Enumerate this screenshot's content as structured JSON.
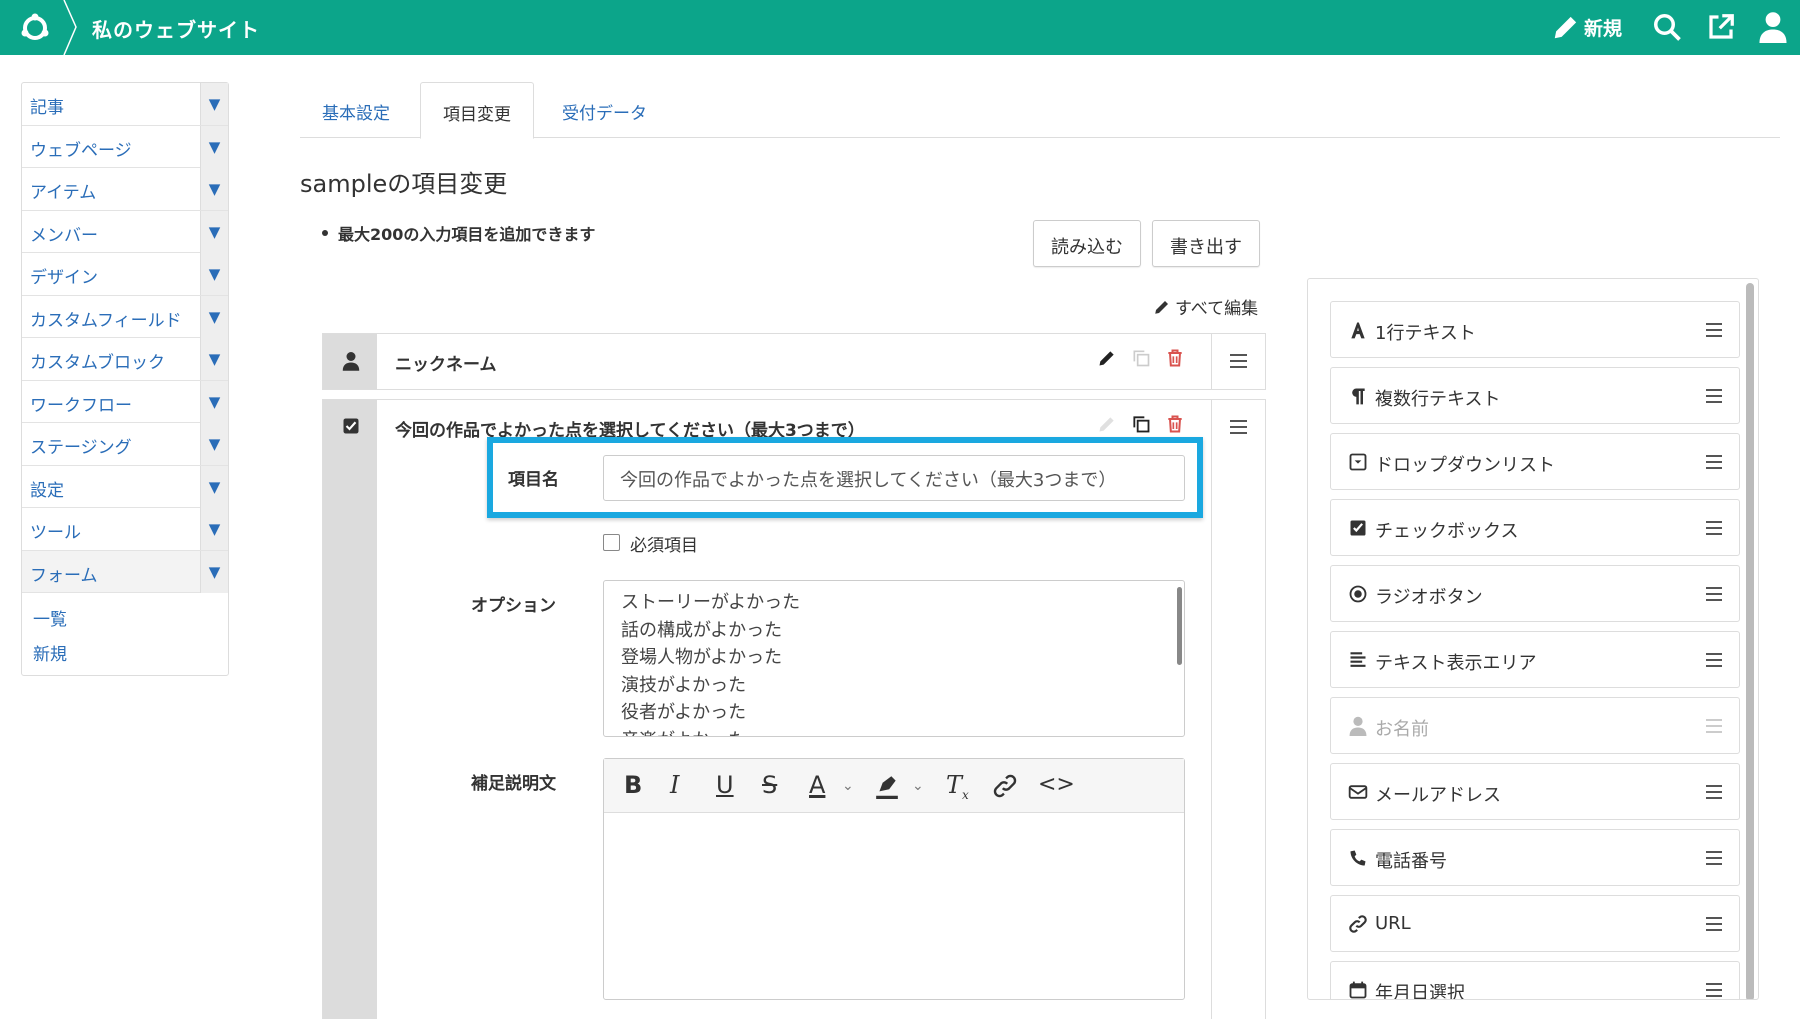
{
  "header": {
    "site_title": "私のウェブサイト",
    "new_label": "新規",
    "icons": [
      "logo-icon",
      "pencil-icon",
      "search-icon",
      "external-link-icon",
      "user-icon"
    ],
    "bg_color": "#0ca58a"
  },
  "sidebar": {
    "items": [
      {
        "label": "記事"
      },
      {
        "label": "ウェブページ"
      },
      {
        "label": "アイテム"
      },
      {
        "label": "メンバー"
      },
      {
        "label": "デザイン"
      },
      {
        "label": "カスタムフィールド"
      },
      {
        "label": "カスタムブロック"
      },
      {
        "label": "ワークフロー"
      },
      {
        "label": "ステージング"
      },
      {
        "label": "設定"
      },
      {
        "label": "ツール"
      },
      {
        "label": "フォーム"
      }
    ],
    "subitems": [
      {
        "label": "一覧"
      },
      {
        "label": "新規"
      }
    ],
    "toggle_glyph": "▼"
  },
  "tabs": [
    {
      "label": "基本設定"
    },
    {
      "label": "項目変更"
    },
    {
      "label": "受付データ"
    }
  ],
  "page_title": "sampleの項目変更",
  "note": "最大200の入力項目を追加できます",
  "buttons": {
    "import": "読み込む",
    "export": "書き出す",
    "edit_all": "すべて編集"
  },
  "fields": [
    {
      "title": "ニックネーム",
      "icon": "user-icon"
    },
    {
      "title": "今回の作品でよかった点を選択してください（最大3つまで）",
      "icon": "checkbox-icon",
      "name_label": "項目名",
      "name_value": "今回の作品でよかった点を選択してください（最大3つまで）",
      "required_label": "必須項目",
      "required": false,
      "options_label": "オプション",
      "options": [
        "ストーリーがよかった",
        "話の構成がよかった",
        "登場人物がよかった",
        "演技がよかった",
        "役者がよかった",
        "音楽がよかった"
      ],
      "desc_label": "補足説明文"
    }
  ],
  "rte_toolbar": [
    "bold-icon",
    "italic-icon",
    "underline-icon",
    "strikethrough-icon",
    "font-color-icon",
    "highlight-icon",
    "clear-format-icon",
    "link-icon",
    "code-icon"
  ],
  "highlight_color": "#1aa8e0",
  "palette": [
    {
      "label": "1行テキスト",
      "icon": "text-a-icon",
      "disabled": false
    },
    {
      "label": "複数行テキスト",
      "icon": "paragraph-icon",
      "disabled": false
    },
    {
      "label": "ドロップダウンリスト",
      "icon": "dropdown-icon",
      "disabled": false
    },
    {
      "label": "チェックボックス",
      "icon": "checkbox-icon",
      "disabled": false
    },
    {
      "label": "ラジオボタン",
      "icon": "radio-icon",
      "disabled": false
    },
    {
      "label": "テキスト表示エリア",
      "icon": "align-left-icon",
      "disabled": false
    },
    {
      "label": "お名前",
      "icon": "user-icon",
      "disabled": true
    },
    {
      "label": "メールアドレス",
      "icon": "envelope-icon",
      "disabled": false
    },
    {
      "label": "電話番号",
      "icon": "phone-icon",
      "disabled": false
    },
    {
      "label": "URL",
      "icon": "link-icon",
      "disabled": false
    },
    {
      "label": "年月日選択",
      "icon": "calendar-icon",
      "disabled": false
    }
  ]
}
